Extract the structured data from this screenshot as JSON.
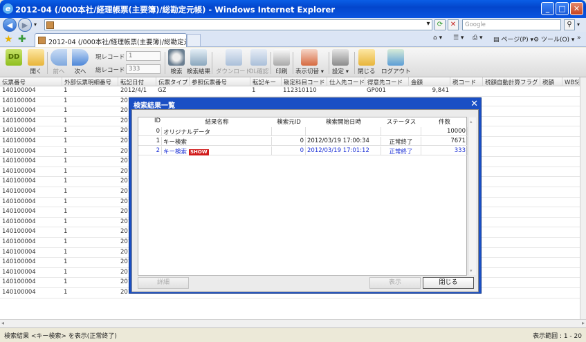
{
  "window": {
    "title": "2012-04 (/000本社/経理帳票(主要簿)/総勘定元帳) - Windows Internet Explorer"
  },
  "browser": {
    "search_placeholder": "Google",
    "tab_title": "2012-04 (/000本社/経理帳票(主要簿)/総勘定元...",
    "tools": {
      "page": "ページ(P)",
      "tool": "ツール(O)"
    }
  },
  "toolbar": {
    "open": "開く",
    "prev": "前へ",
    "next": "次へ",
    "current_record_label": "現レコード :",
    "current_record_value": "1",
    "total_record_label": "総レコード :",
    "total_record_value": "333",
    "search": "検索",
    "search_result": "検索結果",
    "download": "ダウンロード",
    "dl_confirm": "DL確認",
    "print": "印刷",
    "view_switch": "表示切替",
    "settings": "設定",
    "close": "閉じる",
    "logout": "ログアウト"
  },
  "grid": {
    "columns": [
      "伝票番号",
      "外部伝票明細番号",
      "転記日付",
      "伝票タイプ",
      "参照伝票番号",
      "転記キー",
      "勘定科目コード",
      "仕入先コード",
      "得意先コード",
      "金額",
      "税コード",
      "税額自動計算フラグ",
      "税額",
      "WBS要"
    ],
    "first_row": {
      "voucher": "140100004",
      "ext": "1",
      "date": "2012/4/1",
      "type": "GZ",
      "ref": "",
      "key": "1",
      "account": "112310110",
      "vendor": "",
      "customer": "GP001",
      "amount": "9,841"
    },
    "row_voucher": "140100004",
    "row_ext": "1",
    "row_date_prefix": "201",
    "row_count": 21
  },
  "dialog": {
    "title": "検索結果一覧",
    "columns": {
      "id": "ID",
      "name": "結果名称",
      "source_id": "検索元ID",
      "start": "検索開始日時",
      "status": "ステータス",
      "count": "件数"
    },
    "rows": [
      {
        "id": "0",
        "name": "オリジナルデータ",
        "badge": "",
        "source_id": "",
        "start": "",
        "status": "",
        "count": "10000"
      },
      {
        "id": "1",
        "name": "キー検索",
        "badge": "",
        "source_id": "0",
        "start": "2012/03/19 17:00:34",
        "status": "正常終了",
        "count": "7671"
      },
      {
        "id": "2",
        "name": "キー検索",
        "badge": "SHOW",
        "source_id": "0",
        "start": "2012/03/19 17:01:12",
        "status": "正常終了",
        "count": "333"
      }
    ],
    "buttons": {
      "detail": "詳細",
      "display": "表示",
      "close": "閉じる"
    }
  },
  "status": {
    "message": "検索結果 <キー検索> を表示(正常終了)",
    "range": "表示範囲 : 1 - 20"
  }
}
